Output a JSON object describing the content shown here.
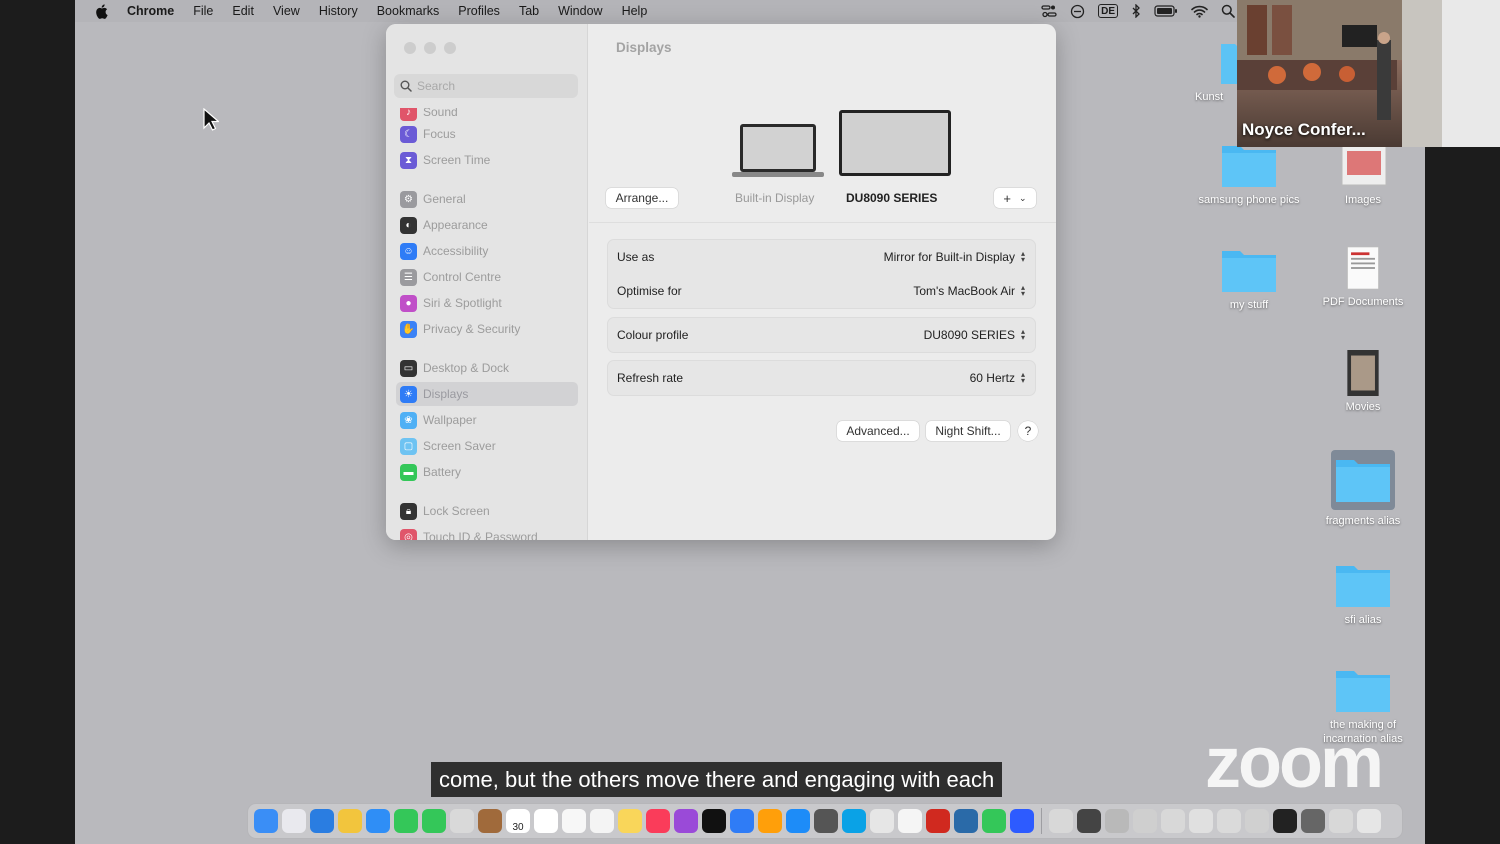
{
  "menubar": {
    "app_name": "Chrome",
    "items": [
      "File",
      "Edit",
      "View",
      "History",
      "Bookmarks",
      "Profiles",
      "Tab",
      "Window",
      "Help"
    ],
    "input_source": "DE"
  },
  "sidebar": {
    "search_placeholder": "Search",
    "items": [
      {
        "label": "Sound",
        "color": "#e0556a"
      },
      {
        "label": "Focus",
        "color": "#6b5bd6"
      },
      {
        "label": "Screen Time",
        "color": "#6b5bd6"
      },
      {
        "label": "General",
        "color": "#9a9a9e"
      },
      {
        "label": "Appearance",
        "color": "#333333"
      },
      {
        "label": "Accessibility",
        "color": "#2f7cf6"
      },
      {
        "label": "Control Centre",
        "color": "#9a9a9e"
      },
      {
        "label": "Siri & Spotlight",
        "color": "#c04fc8"
      },
      {
        "label": "Privacy & Security",
        "color": "#3b82f6"
      },
      {
        "label": "Desktop & Dock",
        "color": "#333333"
      },
      {
        "label": "Displays",
        "color": "#2f7cf6"
      },
      {
        "label": "Wallpaper",
        "color": "#4fb0f5"
      },
      {
        "label": "Screen Saver",
        "color": "#6ec3f2"
      },
      {
        "label": "Battery",
        "color": "#34c759"
      },
      {
        "label": "Lock Screen",
        "color": "#333333"
      },
      {
        "label": "Touch ID & Password",
        "color": "#e0556a"
      }
    ],
    "active_item": "Displays"
  },
  "displays": {
    "title": "Displays",
    "arrange_label": "Arrange...",
    "builtin_label": "Built-in Display",
    "external_label": "DU8090 SERIES",
    "add_label": "+",
    "settings": [
      {
        "label": "Use as",
        "value": "Mirror for Built-in Display"
      },
      {
        "label": "Optimise for",
        "value": "Tom's MacBook Air"
      },
      {
        "label": "Colour profile",
        "value": "DU8090 SERIES"
      },
      {
        "label": "Refresh rate",
        "value": "60 Hertz"
      }
    ],
    "advanced_label": "Advanced...",
    "night_shift_label": "Night Shift...",
    "help_label": "?"
  },
  "desktop": {
    "icons": [
      {
        "label": "Kunst"
      },
      {
        "label": "samsung phone pics"
      },
      {
        "label": "Images"
      },
      {
        "label": "my stuff"
      },
      {
        "label": "PDF Documents"
      },
      {
        "label": "Movies"
      },
      {
        "label": "fragments alias"
      },
      {
        "label": "sfi alias"
      },
      {
        "label": "the making of incarnation alias"
      }
    ]
  },
  "video": {
    "participant_name": "Noyce Confer..."
  },
  "caption": "come, but the others move there and engaging with each",
  "watermark": "zoom",
  "dock": {
    "calendar_day": "30",
    "icon_colors": [
      "#3a8ef6",
      "#e9e9ee",
      "#2a7de1",
      "#f2c53d",
      "#2f8ef6",
      "#34c759",
      "#34c759",
      "#d9d9d9",
      "#a06a3b",
      "#ffffff",
      "#ffffff",
      "#f7f7f7",
      "#f4f4f4",
      "#f9d65a",
      "#fa3c5a",
      "#9a4ad8",
      "#111111",
      "#2f7cf6",
      "#ff9f0a",
      "#1d8cf8",
      "#555555",
      "#0aa2e6",
      "#e6e6e6",
      "#f5f5f5",
      "#d0291f",
      "#2a6aa8",
      "#34c759",
      "#2d5bff",
      "#d8d8d8",
      "#444444",
      "#b9b9b9",
      "#cfcfcf",
      "#d8d8d8",
      "#e0e0e0",
      "#dadada",
      "#d0d0d0",
      "#222222",
      "#666666",
      "#d8d8d8",
      "#e6e6e6"
    ]
  }
}
